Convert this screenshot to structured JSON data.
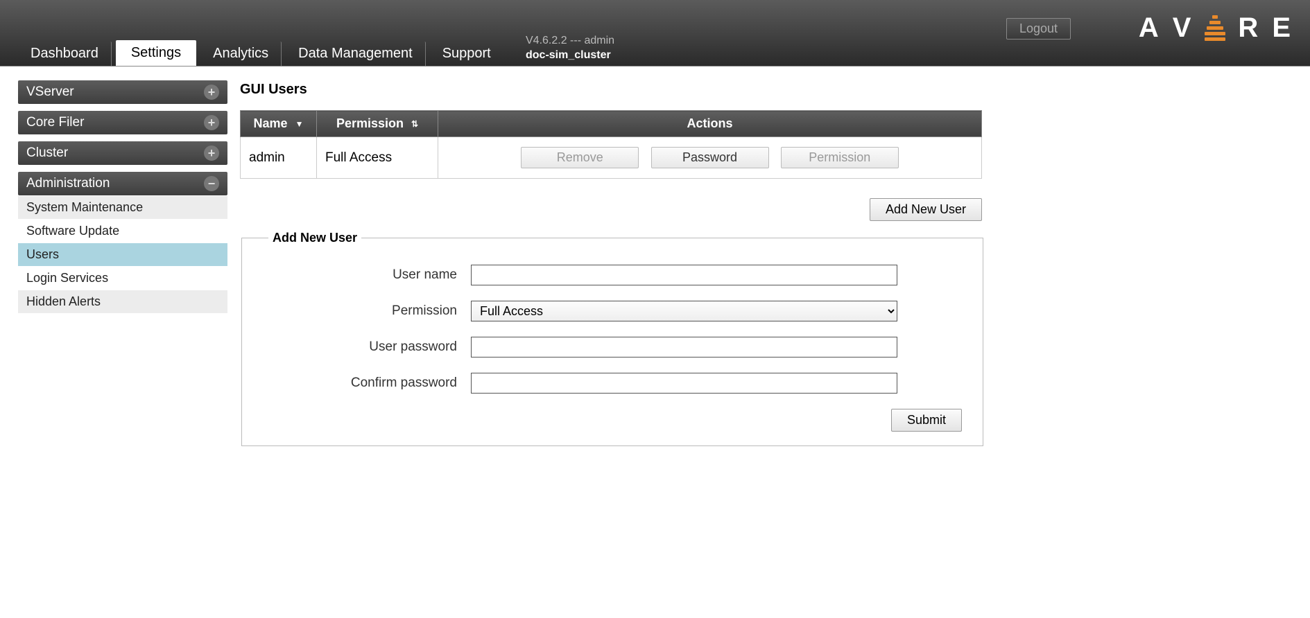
{
  "header": {
    "tabs": [
      "Dashboard",
      "Settings",
      "Analytics",
      "Data Management",
      "Support"
    ],
    "active_tab_index": 1,
    "version_line": "V4.6.2.2 --- admin",
    "cluster_name": "doc-sim_cluster",
    "logout_label": "Logout",
    "logo_text": "AVERE"
  },
  "sidebar": {
    "sections": [
      {
        "title": "VServer",
        "expanded": false,
        "items": []
      },
      {
        "title": "Core Filer",
        "expanded": false,
        "items": []
      },
      {
        "title": "Cluster",
        "expanded": false,
        "items": []
      },
      {
        "title": "Administration",
        "expanded": true,
        "items": [
          {
            "label": "System Maintenance",
            "active": false
          },
          {
            "label": "Software Update",
            "active": false
          },
          {
            "label": "Users",
            "active": true
          },
          {
            "label": "Login Services",
            "active": false
          },
          {
            "label": "Hidden Alerts",
            "active": false
          }
        ]
      }
    ]
  },
  "page": {
    "title": "GUI Users",
    "table": {
      "headers": {
        "name": "Name",
        "permission": "Permission",
        "actions": "Actions"
      },
      "rows": [
        {
          "name": "admin",
          "permission": "Full Access",
          "actions": {
            "remove": {
              "label": "Remove",
              "enabled": false
            },
            "password": {
              "label": "Password",
              "enabled": true
            },
            "permission": {
              "label": "Permission",
              "enabled": false
            }
          }
        }
      ]
    },
    "add_new_user_button": "Add New User",
    "form": {
      "legend": "Add New User",
      "username_label": "User name",
      "username_value": "",
      "permission_label": "Permission",
      "permission_selected": "Full Access",
      "user_password_label": "User password",
      "user_password_value": "",
      "confirm_password_label": "Confirm password",
      "confirm_password_value": "",
      "submit_label": "Submit"
    }
  }
}
